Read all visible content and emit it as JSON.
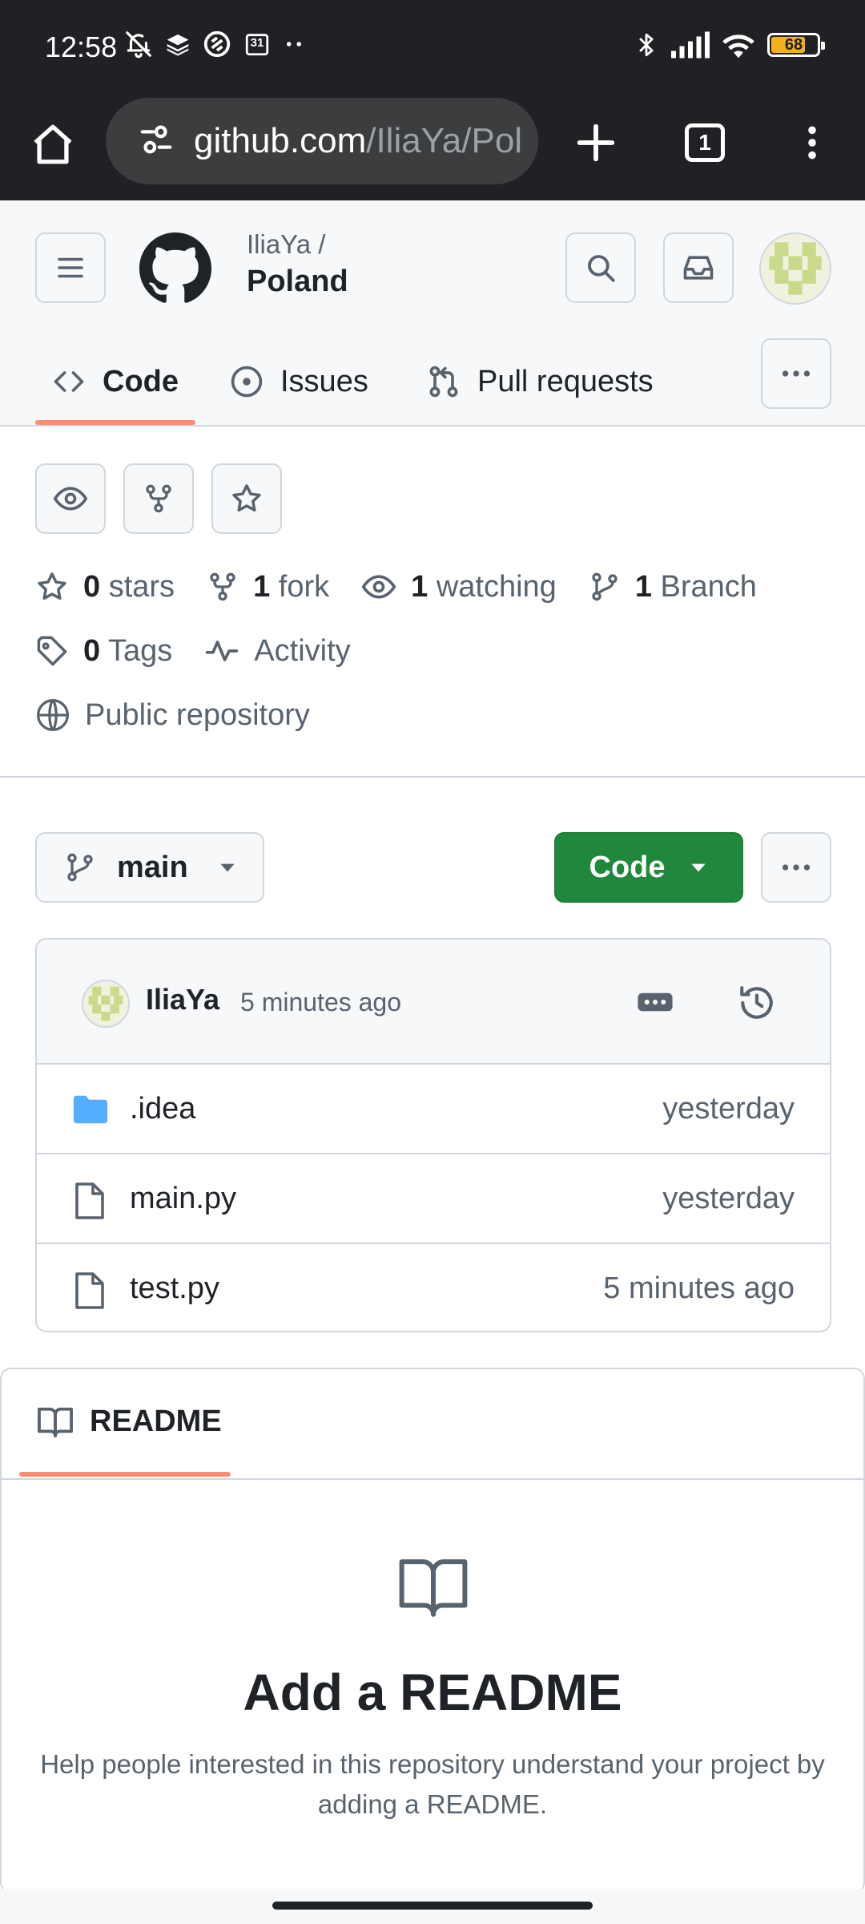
{
  "status_bar": {
    "time": "12:58",
    "calendar_day": "31",
    "battery": "68",
    "left_icons": [
      "bell-off-icon",
      "layers-icon",
      "app-icon",
      "calendar-icon",
      "more-dots-icon"
    ],
    "right_icons": [
      "bluetooth-icon",
      "signal-icon",
      "wifi-icon",
      "battery-icon"
    ]
  },
  "browser": {
    "url_host": "github.com",
    "url_path": "/IliaYa/Pol",
    "tab_count": "1"
  },
  "header": {
    "owner": "IliaYa /",
    "repo": "Poland"
  },
  "tabs": [
    {
      "label": "Code",
      "icon": "code-icon",
      "active": true
    },
    {
      "label": "Issues",
      "icon": "issue-opened-icon"
    },
    {
      "label": "Pull requests",
      "icon": "git-pull-request-icon"
    }
  ],
  "meta": {
    "stars_count": "0",
    "stars_label": "stars",
    "forks_count": "1",
    "forks_label": "fork",
    "watching_count": "1",
    "watching_label": "watching",
    "branch_count": "1",
    "branch_label": "Branch",
    "tags_count": "0",
    "tags_label": "Tags",
    "activity_label": "Activity",
    "visibility_label": "Public repository"
  },
  "branch": {
    "name": "main",
    "code_button": "Code"
  },
  "commit": {
    "author": "IliaYa",
    "time": "5 minutes ago"
  },
  "files": [
    {
      "name": ".idea",
      "type": "folder",
      "date": "yesterday"
    },
    {
      "name": "main.py",
      "type": "file",
      "date": "yesterday"
    },
    {
      "name": "test.py",
      "type": "file",
      "date": "5 minutes ago"
    }
  ],
  "readme": {
    "tab_label": "README",
    "title": "Add a README",
    "text": "Help people interested in this repository understand your project by adding a README."
  },
  "colors": {
    "accent_underline": "#fd8c73",
    "code_button": "#1f883d",
    "folder": "#54aeff",
    "status_bar": "#202124"
  }
}
